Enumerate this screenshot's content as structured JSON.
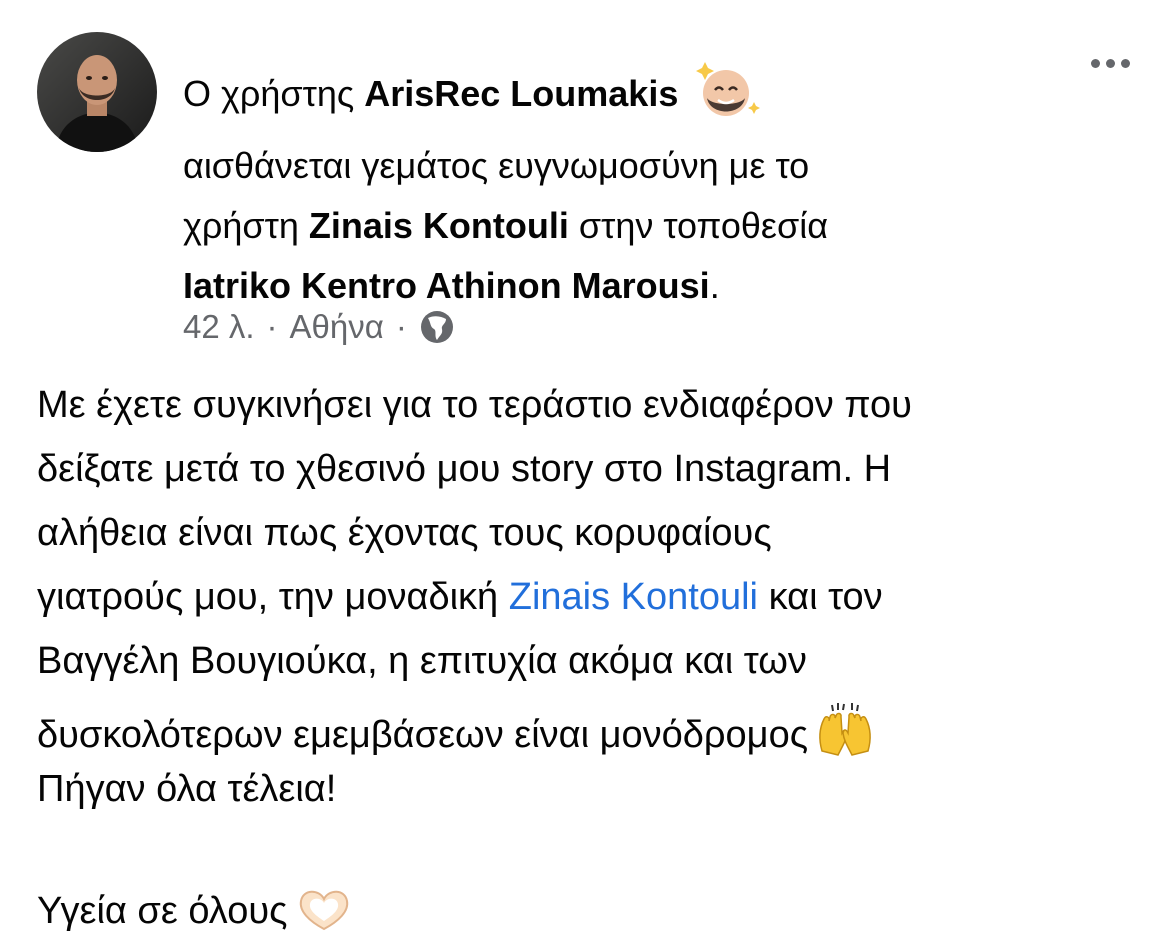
{
  "post": {
    "author_prefix": "Ο χρήστης",
    "author_name": "ArisRec Loumakis",
    "feeling_text": "αισθάνεται γεμάτος ευγνωμοσύνη με το",
    "with_prefix": "χρήστη",
    "tagged_user": "Zinais Kontouli",
    "location_prefix": "στην τοποθεσία",
    "location_name": "Iatriko Kentro Athinon Marousi",
    "location_suffix": ".",
    "time": "42 λ.",
    "city": "Αθήνα",
    "separator": "·",
    "privacy_icon": "globe-icon",
    "feeling_icon": "smiling-face-with-sparkles-icon"
  },
  "content": {
    "line1": "Με έχετε συγκινήσει για το τεράστιο ενδιαφέρον που",
    "line2": "δείξατε μετά το χθεσινό μου story στο Instagram. Η",
    "line3": "αλήθεια είναι πως έχοντας τους κορυφαίους",
    "line4_prefix": "γιατρούς μου, την μοναδική",
    "line4_mention": "Zinais Kontouli",
    "line4_suffix": "και τον",
    "line5": "Βαγγέλη Βουγιούκα, η επιτυχία ακόμα και των",
    "line6": "δυσκολότερων εμεμβάσεων είναι μονόδρομος",
    "line7": "Πήγαν όλα τέλεια!",
    "line8": "Υγεία σε όλους",
    "emoji_line6": "raising-hands-icon",
    "emoji_line8": "heart-hands-icon"
  },
  "colors": {
    "text": "#050505",
    "meta": "#65676b",
    "mention": "#216fdb"
  }
}
